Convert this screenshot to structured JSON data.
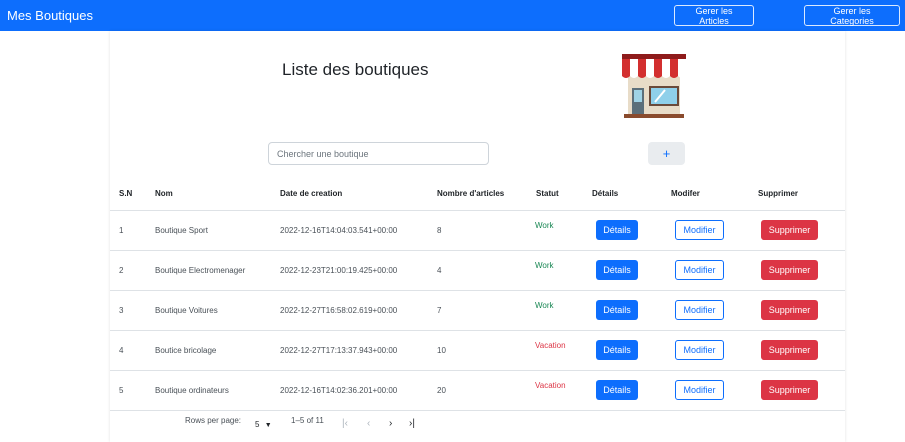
{
  "nav": {
    "brand": "Mes Boutiques",
    "articles_label": "Gerer les Articles",
    "categories_label": "Gerer les Categories"
  },
  "page": {
    "title": "Liste des boutiques",
    "shop_icon": "storefront-icon"
  },
  "search": {
    "placeholder": "Chercher une boutique",
    "value": ""
  },
  "add_label": "+",
  "table": {
    "headers": [
      "S.N",
      "Nom",
      "Date de creation",
      "Nombre d'articles",
      "Statut",
      "Détails",
      "Modifer",
      "Supprimer"
    ],
    "rows": [
      {
        "sn": "1",
        "nom": "Boutique Sport",
        "date": "2022-12-16T14:04:03.541+00:00",
        "articles": "8",
        "statut": "Work",
        "details": "Détails",
        "modifier": "Modifier",
        "supprimer": "Supprimer"
      },
      {
        "sn": "2",
        "nom": "Boutique Electromenager",
        "date": "2022-12-23T21:00:19.425+00:00",
        "articles": "4",
        "statut": "Work",
        "details": "Détails",
        "modifier": "Modifier",
        "supprimer": "Supprimer"
      },
      {
        "sn": "3",
        "nom": "Boutique Voitures",
        "date": "2022-12-27T16:58:02.619+00:00",
        "articles": "7",
        "statut": "Work",
        "details": "Détails",
        "modifier": "Modifier",
        "supprimer": "Supprimer"
      },
      {
        "sn": "4",
        "nom": "Boutice bricolage",
        "date": "2022-12-27T17:13:37.943+00:00",
        "articles": "10",
        "statut": "Vacation",
        "details": "Détails",
        "modifier": "Modifier",
        "supprimer": "Supprimer"
      },
      {
        "sn": "5",
        "nom": "Boutique ordinateurs",
        "date": "2022-12-16T14:02:36.201+00:00",
        "articles": "20",
        "statut": "Vacation",
        "details": "Détails",
        "modifier": "Modifier",
        "supprimer": "Supprimer"
      }
    ]
  },
  "pagination": {
    "rows_label": "Rows per page:",
    "rows_value": "5",
    "range": "1–5 of 11"
  },
  "colors": {
    "primary": "#0d6efd",
    "danger": "#dc3545",
    "success": "#198754"
  }
}
